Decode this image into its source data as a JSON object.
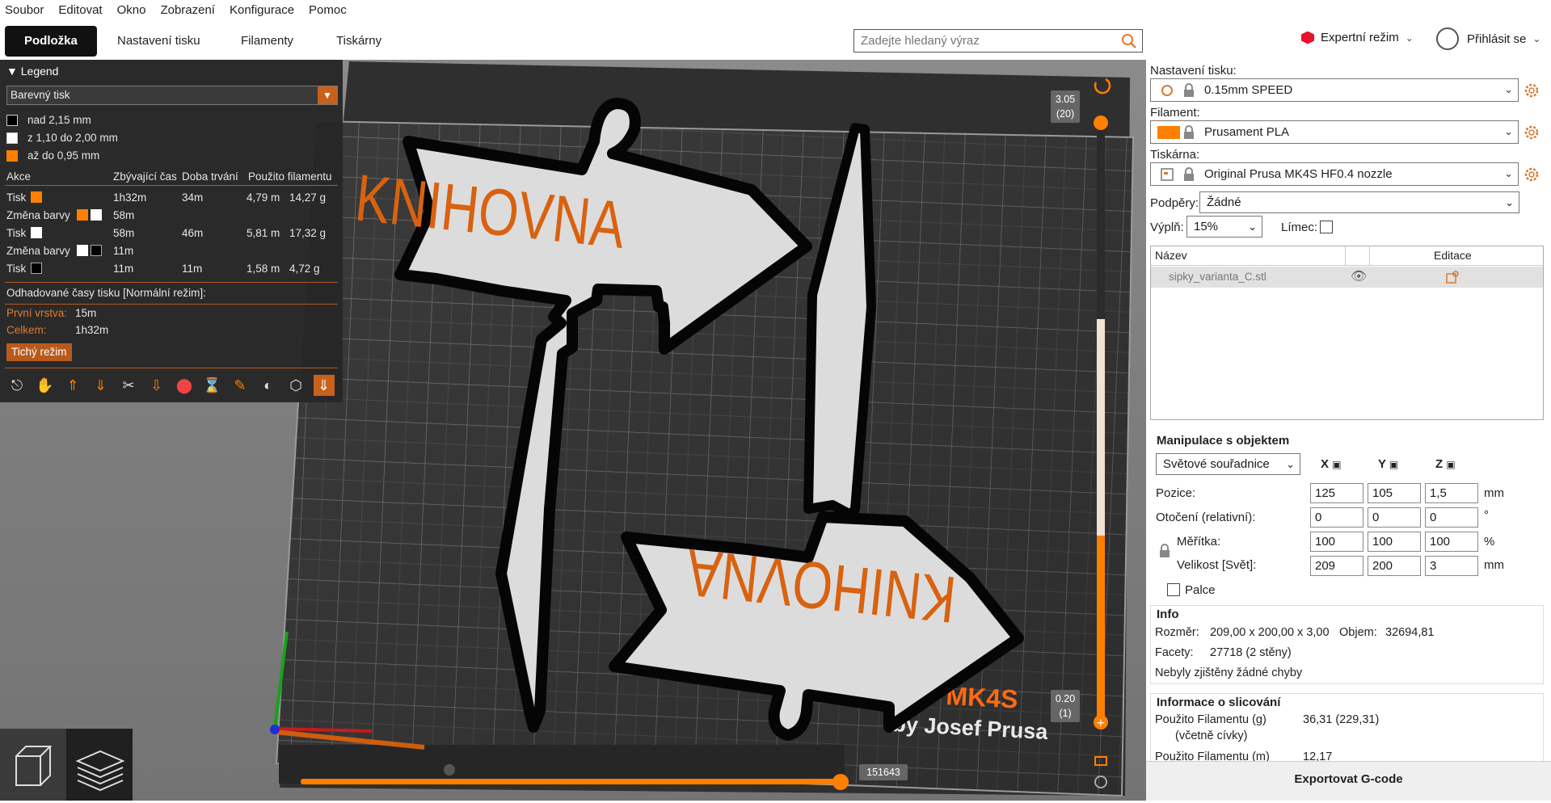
{
  "menu": [
    "Soubor",
    "Editovat",
    "Okno",
    "Zobrazení",
    "Konfigurace",
    "Pomoc"
  ],
  "tabs": [
    "Podložka",
    "Nastavení tisku",
    "Filamenty",
    "Tiskárny"
  ],
  "search": {
    "placeholder": "Zadejte hledaný výraz"
  },
  "mode": {
    "label": "Expertní režim"
  },
  "login": {
    "label": "Přihlásit se"
  },
  "legend": {
    "title": "Legend",
    "view_type": "Barevný tisk",
    "ranges": [
      {
        "label": "nad 2,15 mm",
        "color": "#000000"
      },
      {
        "label": "z 1,10 do 2,00 mm",
        "color": "#ffffff"
      },
      {
        "label": "až do 0,95 mm",
        "color": "#ff8000"
      }
    ],
    "headers": [
      "Akce",
      "Zbývající čas",
      "Doba trvání",
      "Použito filamentu"
    ],
    "rows": [
      {
        "action": "Tisk",
        "remaining": "1h32m",
        "duration": "34m",
        "len": "4,79 m",
        "weight": "14,27 g"
      },
      {
        "action": "Změna barvy",
        "remaining": "58m",
        "duration": "",
        "len": "",
        "weight": ""
      },
      {
        "action": "Tisk",
        "remaining": "58m",
        "duration": "46m",
        "len": "5,81 m",
        "weight": "17,32 g"
      },
      {
        "action": "Změna barvy",
        "remaining": "11m",
        "duration": "",
        "len": "",
        "weight": ""
      },
      {
        "action": "Tisk",
        "remaining": "11m",
        "duration": "11m",
        "len": "1,58 m",
        "weight": "4,72 g"
      }
    ],
    "estimated": "Odhadované časy tisku [Normální režim]:",
    "first_layer_label": "První vrstva:",
    "first_layer": "15m",
    "total_label": "Celkem:",
    "total": "1h32m",
    "quiet_button": "Tichý režim"
  },
  "model_text": {
    "arrow1": "KNIHOVNA",
    "arrow2": "KNIHOVNA"
  },
  "bed_logo": {
    "model": "MK4S",
    "by": "by Josef Prusa"
  },
  "vslider": {
    "top_height": "3.05",
    "top_layer": "(20)",
    "bottom_height": "0.20",
    "bottom_layer": "(1)"
  },
  "hslider": {
    "value": "151643"
  },
  "panel": {
    "print_settings_label": "Nastavení tisku:",
    "print_settings": "0.15mm SPEED",
    "filament_label": "Filament:",
    "filament": "Prusament PLA",
    "filament_color": "#ff7f00",
    "printer_label": "Tiskárna:",
    "printer": "Original Prusa MK4S HF0.4 nozzle",
    "supports_label": "Podpěry:",
    "supports": "Žádné",
    "infill_label": "Výplň:",
    "infill": "15%",
    "brim_label": "Límec:",
    "list_name": "Název",
    "list_edit": "Editace",
    "object_name": "sipky_varianta_C.stl",
    "manip_title": "Manipulace s objektem",
    "coord": "Světové souřadnice",
    "axes": [
      "X",
      "Y",
      "Z"
    ],
    "position_label": "Pozice:",
    "position": [
      "125",
      "105",
      "1,5"
    ],
    "rotation_label": "Otočení (relativní):",
    "rotation": [
      "0",
      "0",
      "0"
    ],
    "scale_label": "Měřítka:",
    "scale": [
      "100",
      "100",
      "100"
    ],
    "size_label": "Velikost [Svět]:",
    "size": [
      "209",
      "200",
      "3"
    ],
    "unit_mm": "mm",
    "unit_deg": "°",
    "unit_pct": "%",
    "inches_label": "Palce",
    "info_title": "Info",
    "size_info_label": "Rozměr:",
    "size_info": "209,00 x 200,00 x 3,00",
    "volume_label": "Objem:",
    "volume": "32694,81",
    "facets_label": "Facety:",
    "facets": "27718 (2 stěny)",
    "errors": "Nebyly zjištěny žádné chyby",
    "slice_title": "Informace o slicování",
    "filament_used_g_label": "Použito Filamentu (g)",
    "filament_used_g_sub": "(včetně cívky)",
    "filament_used_g": "36,31 (229,31)",
    "filament_used_m_label": "Použito Filamentu (m)",
    "filament_used_m": "12,17",
    "export": "Exportovat G-code"
  }
}
